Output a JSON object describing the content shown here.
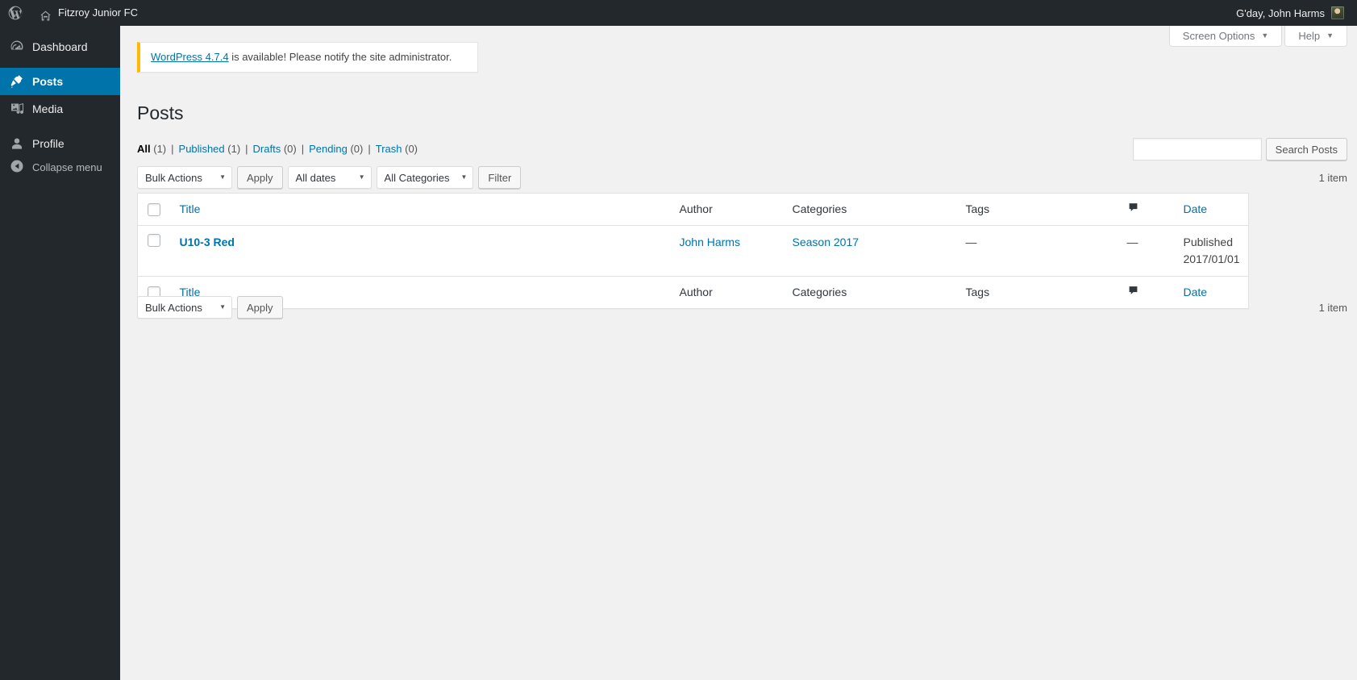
{
  "adminbar": {
    "logo_icon": "wordpress-logo-icon",
    "site_name": "Fitzroy Junior FC",
    "site_icon": "home-icon",
    "greeting": "G'day, John Harms",
    "avatar": "user-avatar"
  },
  "sidebar": {
    "items": [
      {
        "label": "Dashboard",
        "icon": "dashboard-icon",
        "current": false
      },
      {
        "label": "Posts",
        "icon": "pin-icon",
        "current": true
      },
      {
        "label": "Media",
        "icon": "media-icon",
        "current": false
      },
      {
        "label": "Profile",
        "icon": "user-icon",
        "current": false
      }
    ],
    "collapse": {
      "label": "Collapse menu",
      "icon": "collapse-arrow-icon"
    }
  },
  "screen_meta": {
    "screen_options": "Screen Options",
    "help": "Help",
    "caret": "▼"
  },
  "notice": {
    "link_text": "WordPress 4.7.4",
    "rest_text": " is available! Please notify the site administrator."
  },
  "page": {
    "title": "Posts"
  },
  "views": [
    {
      "label": "All",
      "count": "(1)",
      "current": true
    },
    {
      "label": "Published",
      "count": "(1)",
      "current": false
    },
    {
      "label": "Drafts",
      "count": "(0)",
      "current": false
    },
    {
      "label": "Pending",
      "count": "(0)",
      "current": false
    },
    {
      "label": "Trash",
      "count": "(0)",
      "current": false
    }
  ],
  "view_separator": "|",
  "search": {
    "value": "",
    "placeholder": "",
    "button_label": "Search Posts"
  },
  "toolbar_top": {
    "bulk_actions": "Bulk Actions",
    "apply": "Apply",
    "dates": "All dates",
    "categories": "All Categories",
    "filter": "Filter",
    "count": "1 item"
  },
  "toolbar_bottom": {
    "bulk_actions": "Bulk Actions",
    "apply": "Apply",
    "count": "1 item"
  },
  "table": {
    "columns": {
      "title": "Title",
      "author": "Author",
      "categories": "Categories",
      "tags": "Tags",
      "comments": "comment-bubble-icon",
      "date": "Date"
    },
    "rows": [
      {
        "title": "U10-3 Red",
        "author": "John Harms",
        "categories": "Season 2017",
        "tags": "—",
        "comments": "—",
        "date_status": "Published",
        "date_value": "2017/01/01"
      }
    ]
  },
  "colors": {
    "admin_bg": "#23282d",
    "accent": "#0073aa",
    "notice_border": "#ffb900",
    "page_bg": "#f1f1f1"
  }
}
